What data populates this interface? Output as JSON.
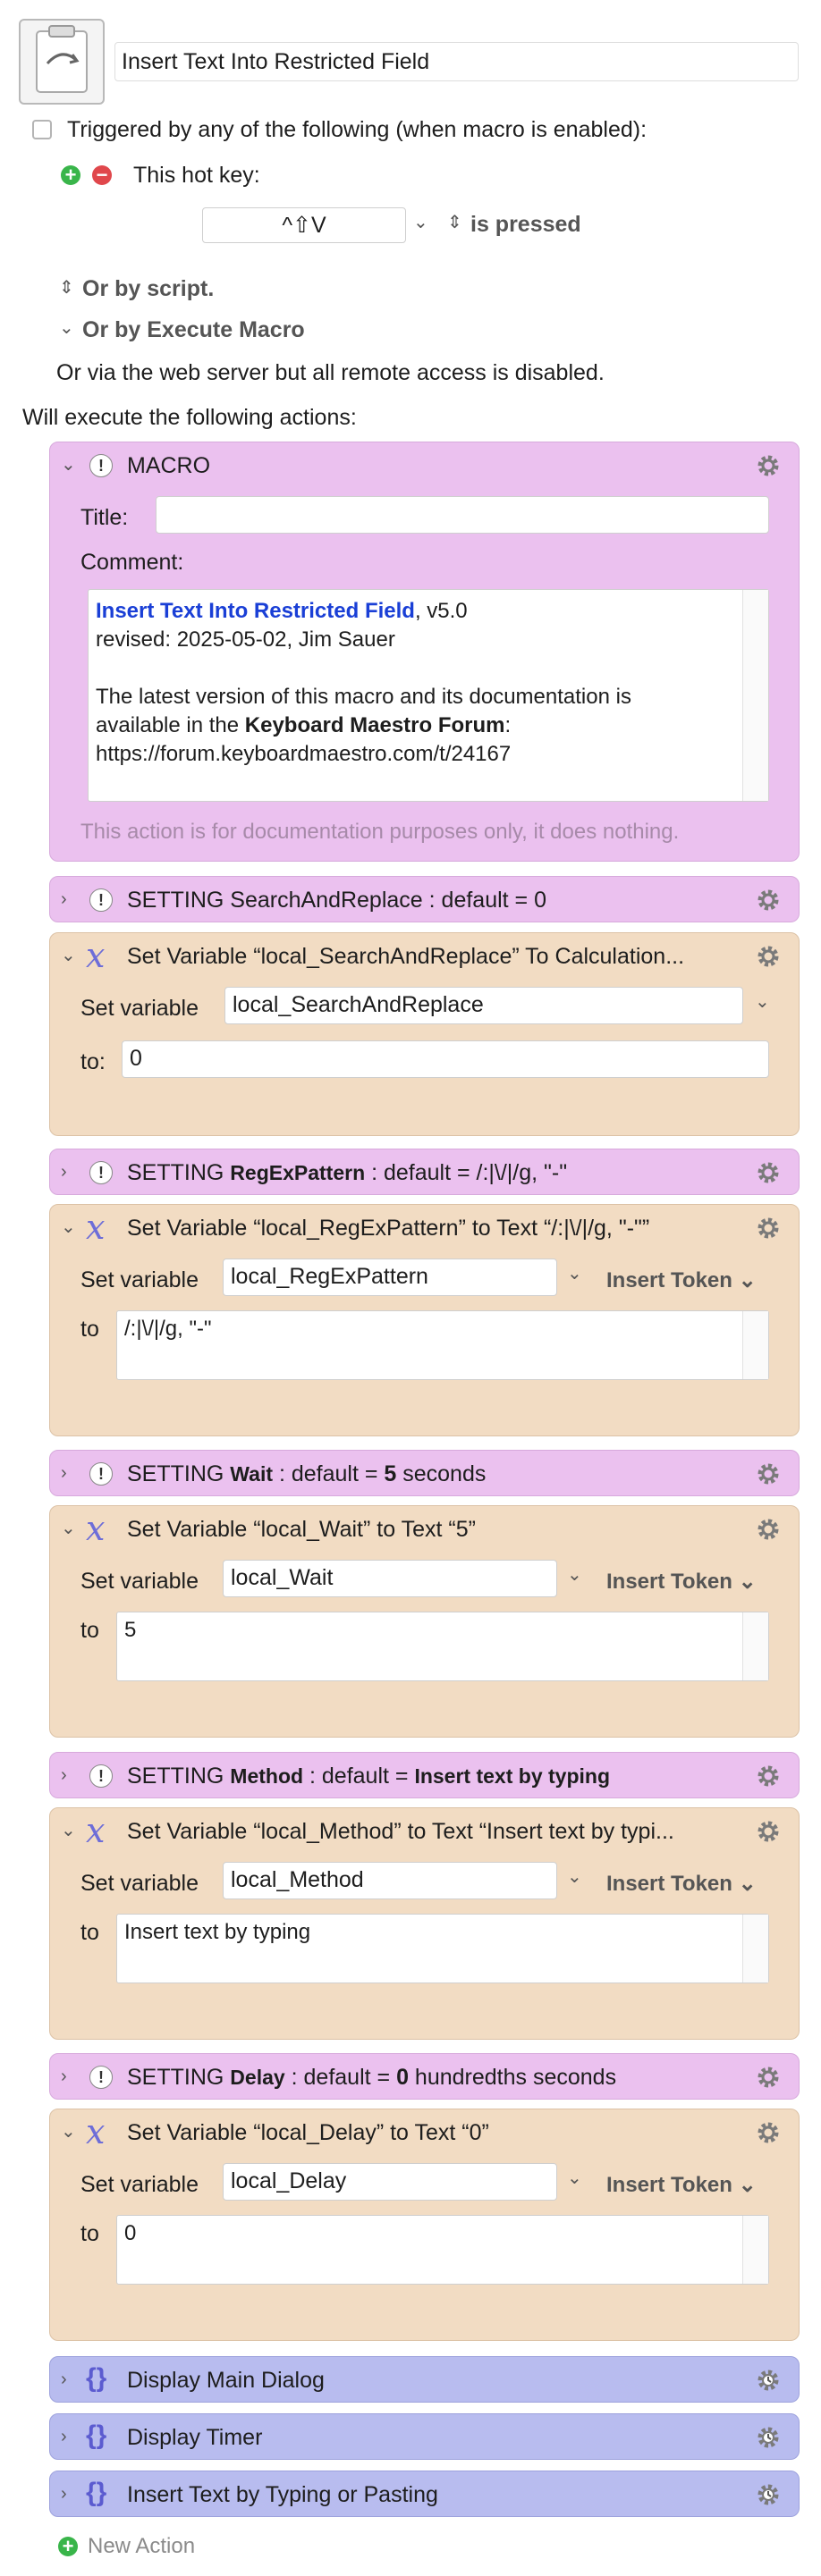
{
  "macro": {
    "name": "Insert Text Into Restricted Field"
  },
  "triggers": {
    "triggered_label": "Triggered by any of the following (when macro is enabled):",
    "hotkey_label": "This hot key:",
    "hotkey_value": "^⇧V",
    "hotkey_state": "is pressed",
    "or_script": "Or by script.",
    "or_execute": "Or by Execute Macro",
    "web_server": "Or via the web server but all remote access is disabled."
  },
  "actions_header": "Will execute the following actions:",
  "macro_comment": {
    "title": "MACRO",
    "title_label": "Title:",
    "comment_label": "Comment:",
    "link_text": "Insert Text Into Restricted Field",
    "version": ", v5.0",
    "revised": "revised: 2025-05-02, Jim Sauer",
    "latest_line1": "The latest version of this macro and its documentation is",
    "latest_prefix": "available in the ",
    "forum_name": "Keyboard Maestro Forum",
    "latest_suffix": ":",
    "forum_url": "https://forum.keyboardmaestro.com/t/24167",
    "doc_note": "This action is for documentation purposes only, it does nothing."
  },
  "settings": {
    "search": {
      "prefix": "SETTING SearchAndReplace : default = 0"
    },
    "regex": {
      "prefix": "SETTING ",
      "name": "RegExPattern",
      "mid": " : default = /:|\\/|/g, \"-\""
    },
    "wait": {
      "prefix": "SETTING ",
      "name": "Wait",
      "mid": " : default = ",
      "value": "5",
      "suffix": " seconds"
    },
    "method": {
      "prefix": "SETTING ",
      "name": "Method",
      "mid": " : default = ",
      "value": "Insert text by typing"
    },
    "delay": {
      "prefix": "SETTING ",
      "name": "Delay",
      "mid": " : default = ",
      "value": "0",
      "suffix": " hundredths seconds"
    }
  },
  "set_actions": {
    "search": {
      "title": "Set Variable “local_SearchAndReplace” To Calculation...",
      "set_label": "Set variable",
      "var": "local_SearchAndReplace",
      "to_label": "to:",
      "value": "0"
    },
    "regex": {
      "title": "Set Variable “local_RegExPattern” to Text “/:|\\/|/g, \"-\"”",
      "set_label": "Set variable",
      "var": "local_RegExPattern",
      "to_label": "to",
      "value": "/:|\\/|/g, \"-\"",
      "token": "Insert Token"
    },
    "wait": {
      "title": "Set Variable “local_Wait” to Text “5”",
      "set_label": "Set variable",
      "var": "local_Wait",
      "to_label": "to",
      "value": "5",
      "token": "Insert Token"
    },
    "method": {
      "title": "Set Variable “local_Method” to Text “Insert text by typi...",
      "set_label": "Set variable",
      "var": "local_Method",
      "to_label": "to",
      "value": "Insert text by typing",
      "token": "Insert Token"
    },
    "delay": {
      "title": "Set Variable “local_Delay” to Text “0”",
      "set_label": "Set variable",
      "var": "local_Delay",
      "to_label": "to",
      "value": "0",
      "token": "Insert Token"
    }
  },
  "groups": [
    {
      "title": "Display Main Dialog"
    },
    {
      "title": "Display Timer"
    },
    {
      "title": "Insert Text by Typing or Pasting"
    }
  ],
  "new_action": "New Action",
  "colors": {
    "macro_pink": "#ebc1ef",
    "variable_tan": "#f2dcc3",
    "group_blue": "#b8bcef",
    "add_green": "#39b54a",
    "remove_red": "#e0474c",
    "link_blue": "#1a3fd6"
  }
}
